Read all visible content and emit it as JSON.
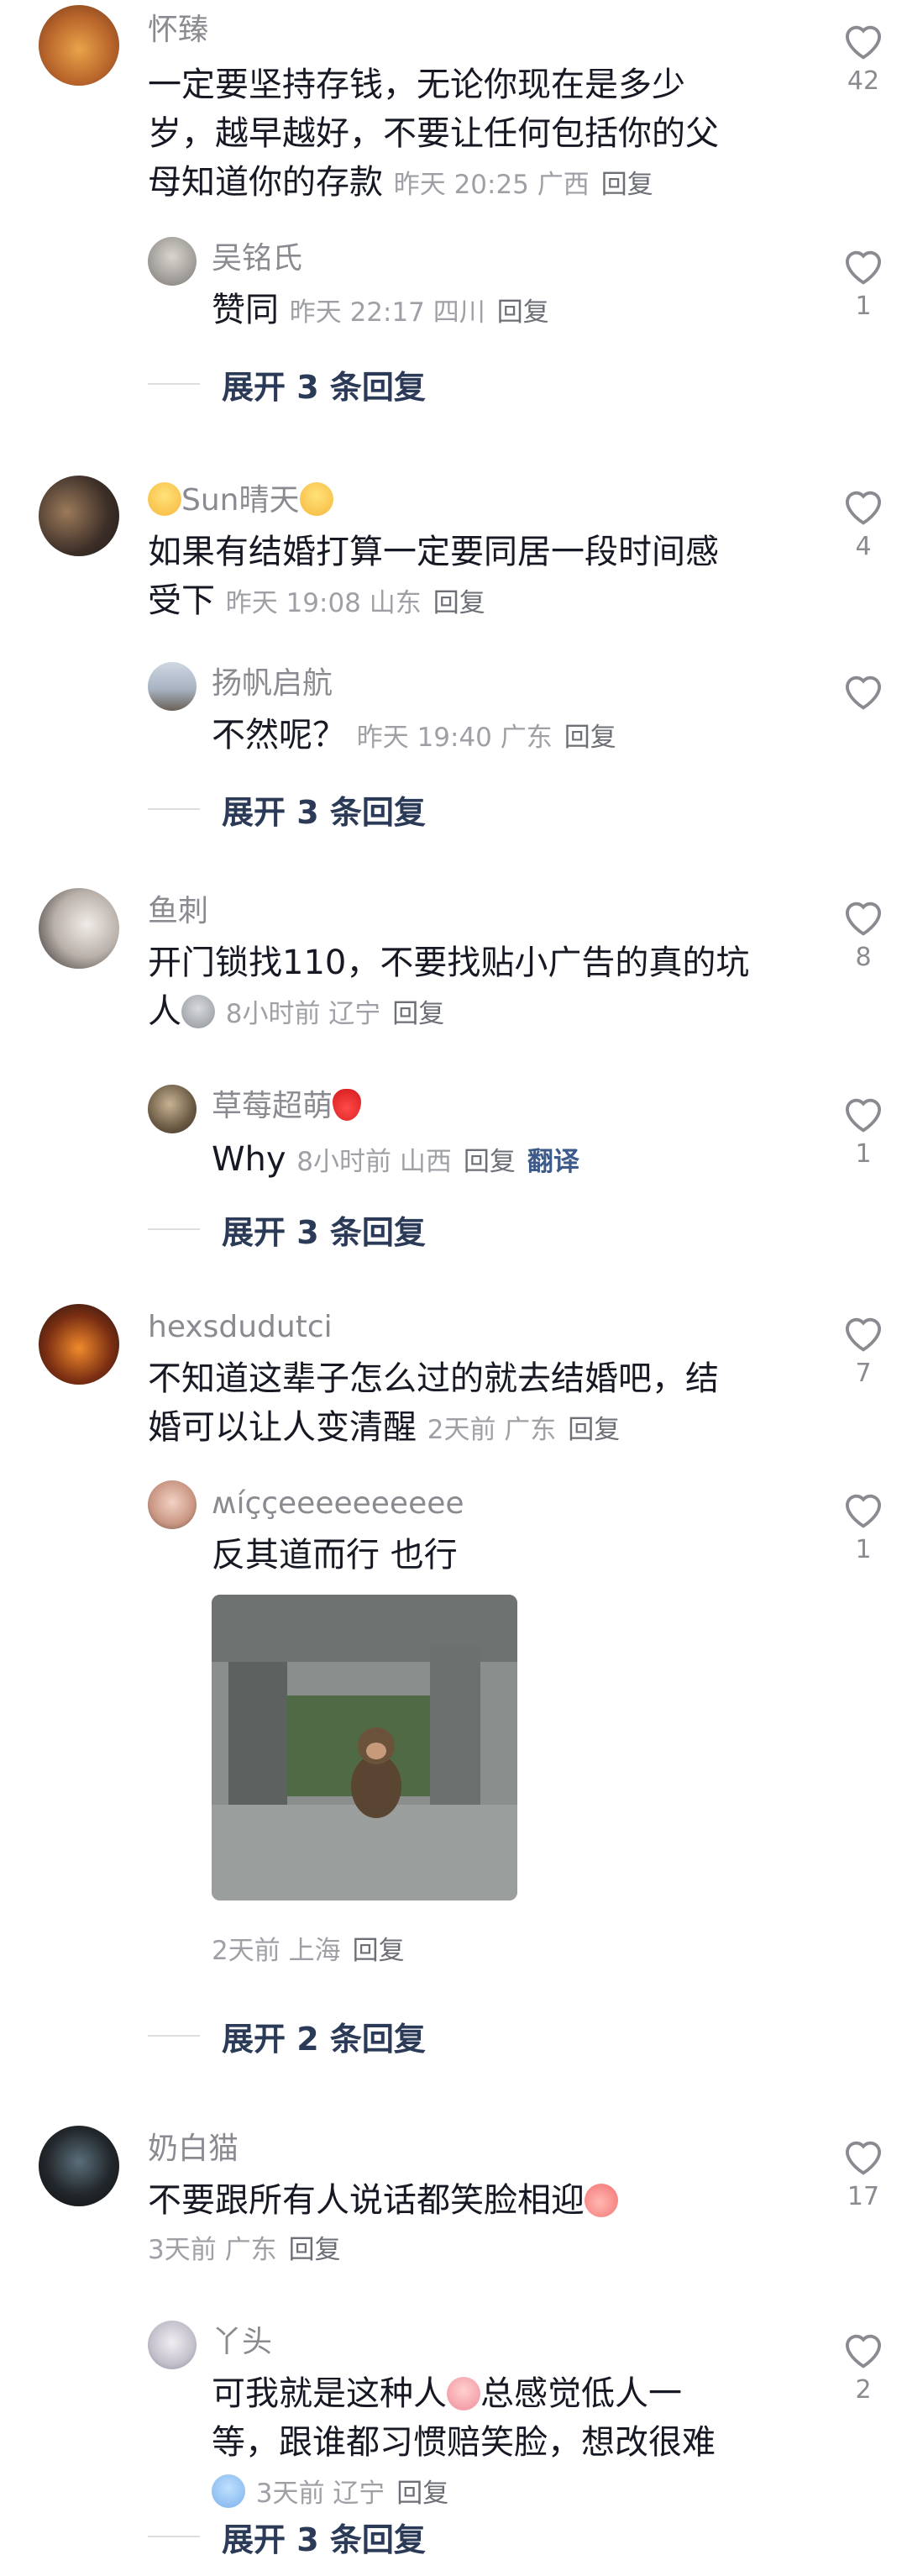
{
  "comments": [
    {
      "username": "怀臻",
      "text": "一定要坚持存钱，无论你现在是多少岁，越早越好，不要让任何包括你的父母知道你的存款",
      "line1": "一定要坚持存钱，无论你现在是多少",
      "line2": "岁，越早越好，不要让任何包括你的父",
      "line3": "母知道你的存款",
      "meta": "昨天 20:25 广西",
      "reply_label": "回复",
      "likes": "42",
      "reply": {
        "username": "吴铭氏",
        "text": "赞同",
        "meta": "昨天 22:17 四川",
        "reply_label": "回复",
        "likes": "1"
      },
      "expand_label": "展开 3 条回复"
    },
    {
      "username": "Sun晴天",
      "text": "如果有结婚打算一定要同居一段时间感受下",
      "line1": "如果有结婚打算一定要同居一段时间感",
      "line2": "受下",
      "meta": "昨天 19:08 山东",
      "reply_label": "回复",
      "likes": "4",
      "reply": {
        "username": "扬帆启航",
        "text": "不然呢？",
        "meta": "昨天 19:40 广东",
        "reply_label": "回复"
      },
      "expand_label": "展开 3 条回复"
    },
    {
      "username": "鱼刺",
      "text": "开门锁找110，不要找贴小广告的真的坑人",
      "line1": "开门锁找110，不要找贴小广告的真的坑",
      "line2": "人",
      "meta": "8小时前 辽宁",
      "reply_label": "回复",
      "likes": "8",
      "reply": {
        "username": "草莓超萌",
        "text": "Why",
        "meta": "8小时前 山西",
        "reply_label": "回复",
        "translate_label": "翻译",
        "likes": "1"
      },
      "expand_label": "展开 3 条回复"
    },
    {
      "username": "hexsdudutci",
      "text": "不知道这辈子怎么过的就去结婚吧，结婚可以让人变清醒",
      "line1": "不知道这辈子怎么过的就去结婚吧，结",
      "line2": "婚可以让人变清醒",
      "meta": "2天前 广东",
      "reply_label": "回复",
      "likes": "7",
      "reply": {
        "username": "ʍíççeeeeeeeeee",
        "text": "反其道而行 也行",
        "meta": "2天前 上海",
        "reply_label": "回复",
        "likes": "1"
      },
      "expand_label": "展开 2 条回复"
    },
    {
      "username": "奶白猫",
      "text": "不要跟所有人说话都笑脸相迎",
      "meta": "3天前 广东",
      "reply_label": "回复",
      "likes": "17",
      "reply": {
        "username": "丫头",
        "text": "可我就是这种人总感觉低人一等，跟谁都习惯赔笑脸，想改很难",
        "line1a": "可我就是这种人",
        "line1b": "总感觉低人一",
        "line2": "等，跟谁都习惯赔笑脸，想改很难",
        "meta": "3天前 辽宁",
        "reply_label": "回复",
        "likes": "2"
      },
      "expand_label": "展开 3 条回复"
    }
  ],
  "icons": {
    "like": "heart-outline-icon"
  },
  "colors": {
    "text": "#161823",
    "muted": "#8a8b91",
    "expand": "#2b3a57"
  }
}
